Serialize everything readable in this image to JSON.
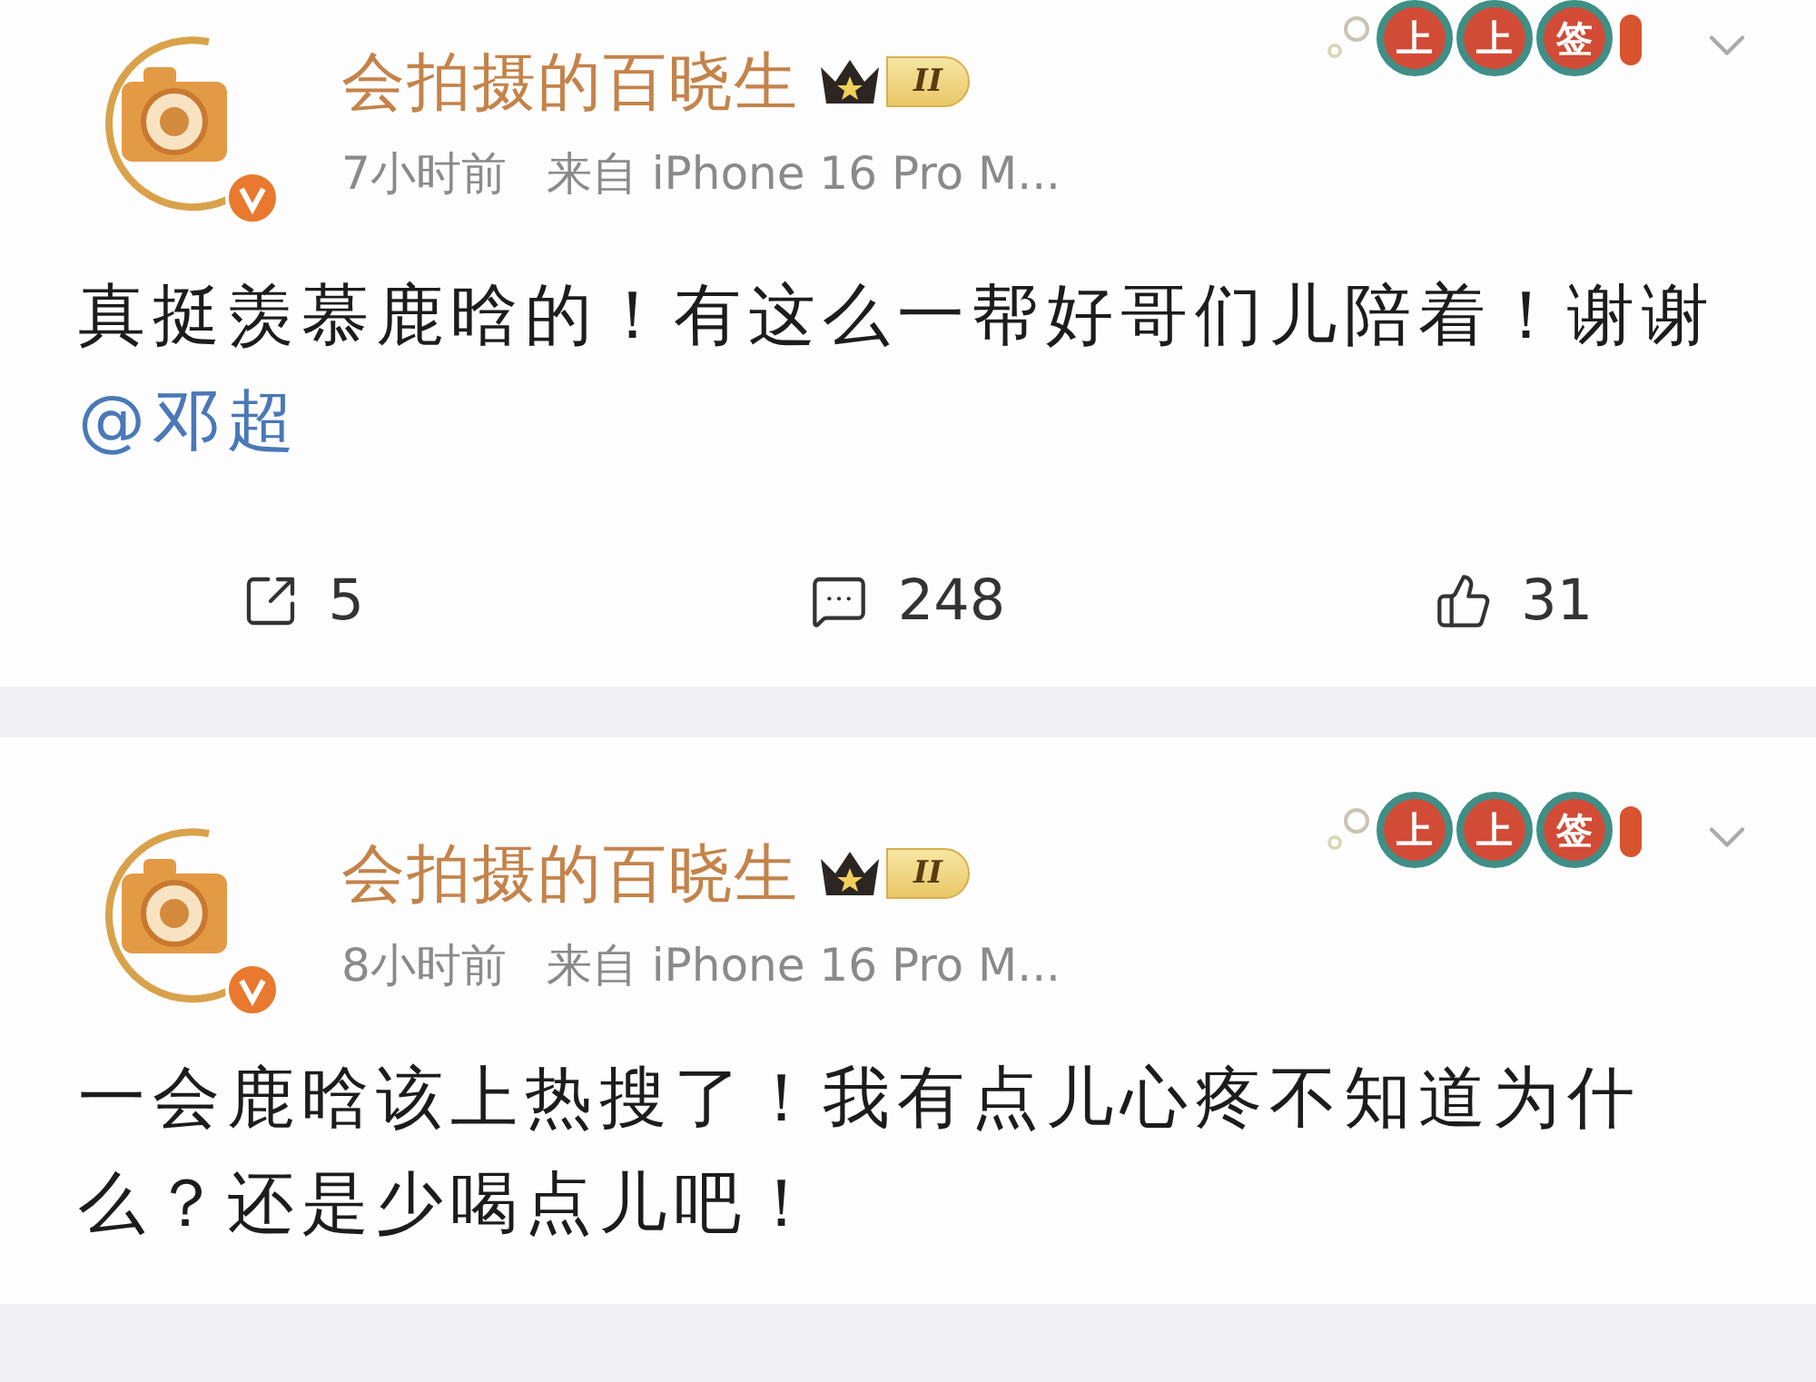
{
  "posts": [
    {
      "author": {
        "name": "会拍摄的百晓生",
        "verified": true,
        "level": "II"
      },
      "time": "7小时前",
      "source": "来自 iPhone 16 Pro M...",
      "badge": [
        "上",
        "上",
        "签"
      ],
      "text": "真挺羡慕鹿晗的！有这么一帮好哥们儿陪着！谢谢",
      "mention": "@邓超",
      "actions": [
        {
          "kind": "repost",
          "count": "5"
        },
        {
          "kind": "comment",
          "count": "248"
        },
        {
          "kind": "like",
          "count": "31"
        }
      ]
    },
    {
      "author": {
        "name": "会拍摄的百晓生",
        "verified": true,
        "level": "II"
      },
      "time": "8小时前",
      "source": "来自 iPhone 16 Pro M...",
      "badge": [
        "上",
        "上",
        "签"
      ],
      "text": "一会鹿晗该上热搜了！我有点儿心疼不知道为什么？还是少喝点儿吧！"
    }
  ]
}
